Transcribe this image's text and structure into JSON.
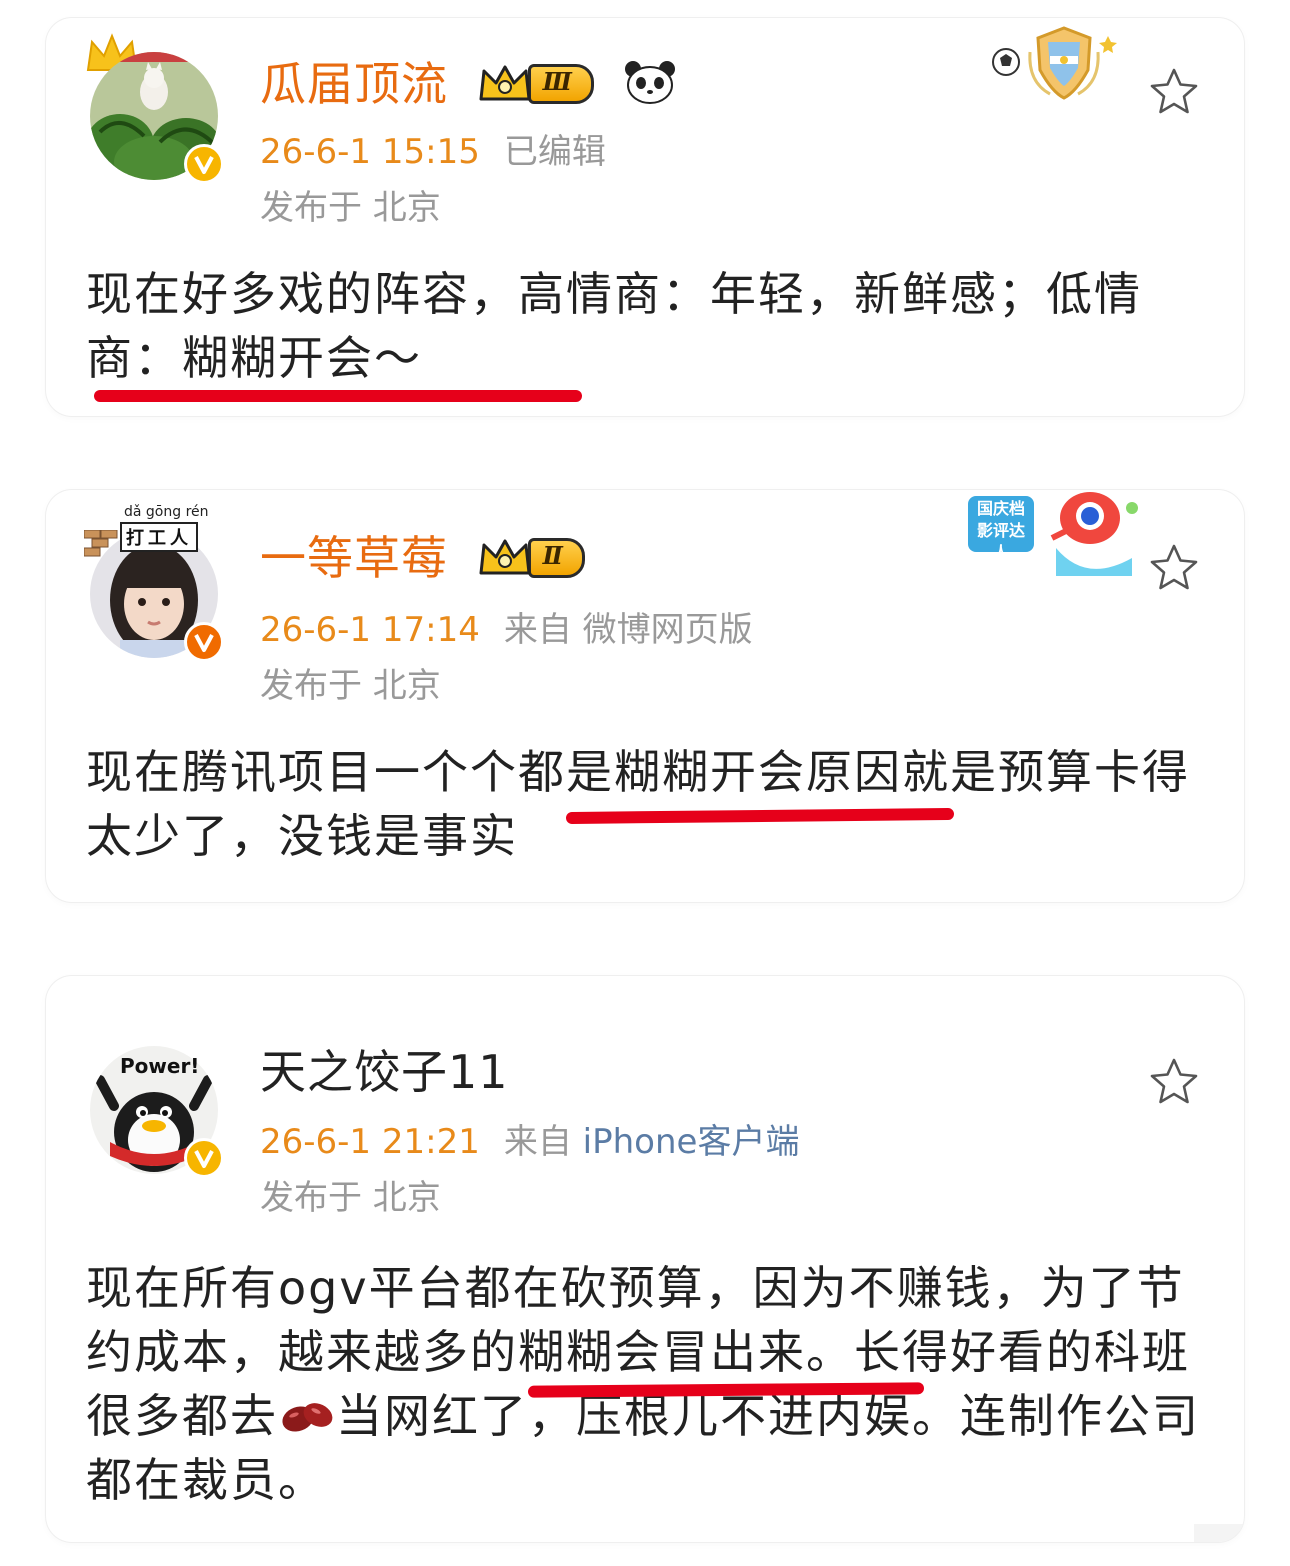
{
  "posts": [
    {
      "username": "瓜届顶流",
      "level": "Ⅲ",
      "time": "26-6-1 15:15",
      "source": "已编辑",
      "source_link": "",
      "location": "发布于 北京",
      "text": "现在好多戏的阵容，高情商：年轻，新鲜感；低情商：糊糊开会～"
    },
    {
      "username": "一等草莓",
      "level": "Ⅱ",
      "avatar_caption": "dǎ gōng rén",
      "avatar_sign": "打工人",
      "badge_text": "国庆档 影评达人",
      "time": "26-6-1 17:14",
      "source": "来自 ",
      "source_link": "微博网页版",
      "location": "发布于 北京",
      "text": "现在腾讯项目一个个都是糊糊开会原因就是预算卡得太少了，没钱是事实"
    },
    {
      "username": "天之饺子11",
      "avatar_caption": "Power!",
      "time": "26-6-1 21:21",
      "source": "来自 ",
      "source_link": "iPhone客户端",
      "location": "发布于 北京",
      "text_part1": "现在所有ogv平台都在砍预算，因为不赚钱，为了节约成本，越来越多的糊糊会冒出来。长得好看的科班很多都去",
      "text_part2": "当网红了，压根儿不进内娱。连制作公司都在裁员。"
    }
  ],
  "colors": {
    "username": "#e86b10",
    "time": "#e88a1a",
    "underline": "#e6001a"
  },
  "icons": [
    "star-outline-icon",
    "verified-v-icon",
    "crown-level-icon",
    "panda-icon",
    "kidney-bean-emoji"
  ]
}
